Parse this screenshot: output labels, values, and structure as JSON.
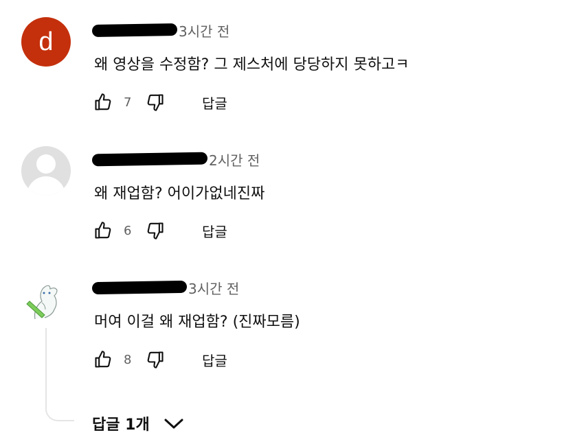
{
  "comments": [
    {
      "avatar_letter": "d",
      "avatar_color": "#c4300c",
      "time": "3시간 전",
      "text": "왜 영상을 수정함? 그 제스처에 당당하지 못하고ㅋ",
      "likes": "7",
      "reply_label": "답글"
    },
    {
      "time": "2시간 전",
      "text": "왜 재업함? 어이가없네진짜",
      "likes": "6",
      "reply_label": "답글"
    },
    {
      "time": "3시간 전",
      "text": "머여 이걸 왜 재업함? (진짜모름)",
      "likes": "8",
      "reply_label": "답글"
    }
  ],
  "replies_toggle": {
    "label": "답글 1개"
  }
}
